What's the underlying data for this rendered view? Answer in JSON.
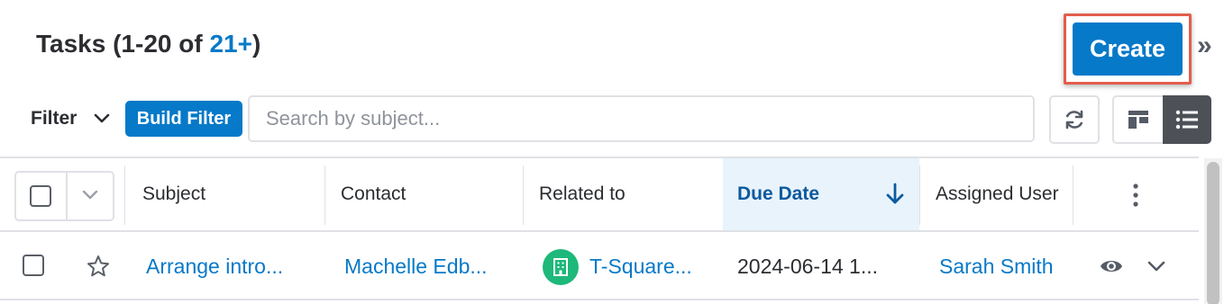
{
  "header": {
    "title_prefix": "Tasks (1-20 of ",
    "count": "21+",
    "title_suffix": ")",
    "create_label": "Create",
    "collapse_icon": "double-chevron-right-icon"
  },
  "toolbar": {
    "filter_label": "Filter",
    "build_filter_label": "Build Filter",
    "search_placeholder": "Search by subject...",
    "search_value": "",
    "refresh_icon": "refresh-icon",
    "view_tile_icon": "tile-view-icon",
    "view_list_icon": "list-view-icon",
    "active_view": "list"
  },
  "table": {
    "columns": [
      "Subject",
      "Contact",
      "Related to",
      "Due Date",
      "Assigned User"
    ],
    "sorted_column": "Due Date",
    "sort_direction": "descending",
    "rows": [
      {
        "subject": "Arrange intro...",
        "contact": "Machelle Edb...",
        "related_to": "T-Square...",
        "due_date": "2024-06-14 1...",
        "assigned_user": "Sarah Smith",
        "favorite": false,
        "checked": false
      }
    ]
  },
  "colors": {
    "accent": "#0679c8",
    "highlight_border": "#e25d4c",
    "sorted_column_bg": "#e9f3fc",
    "account_icon_bg": "#1eb87a",
    "active_view_bg": "#4d5157"
  }
}
